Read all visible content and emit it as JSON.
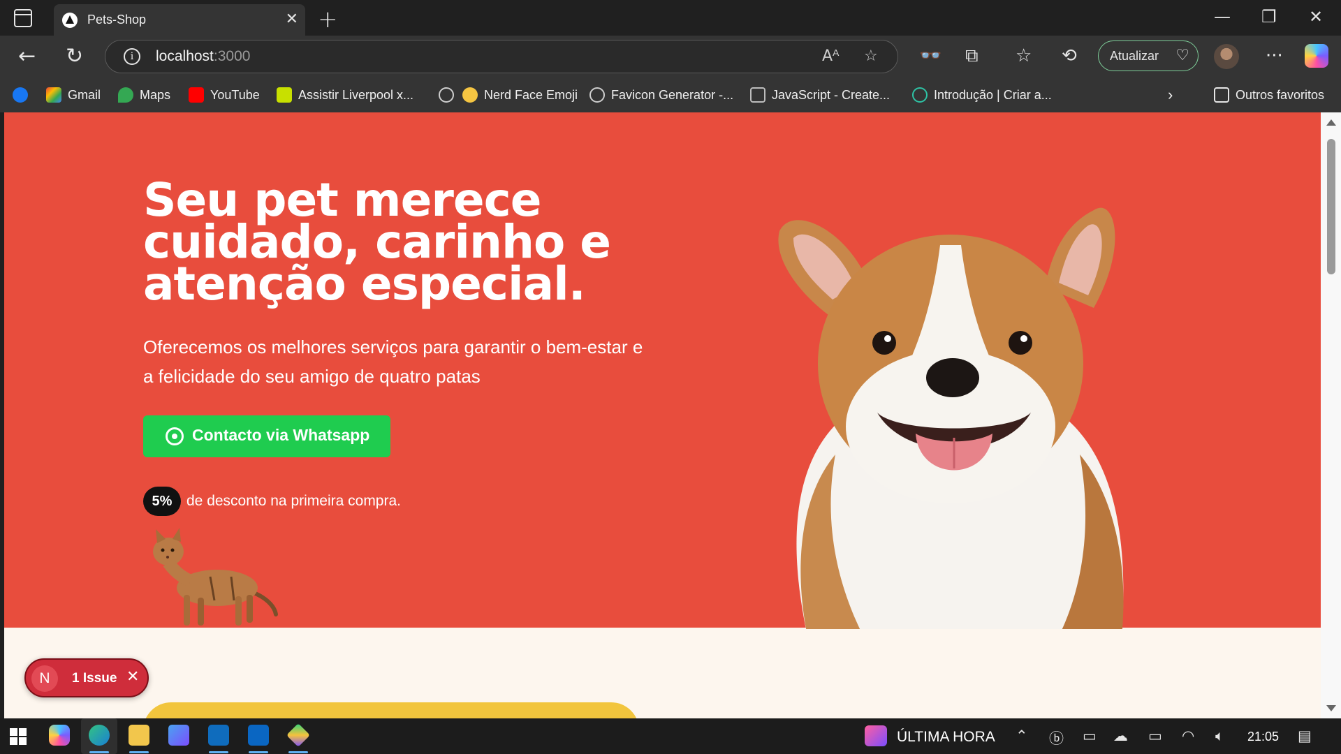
{
  "browser": {
    "tab_title": "Pets-Shop",
    "tab_close": "✕",
    "new_tab": "+",
    "address_host": "localhost",
    "address_port": ":3000",
    "update_label": "Atualizar",
    "window_controls": {
      "minimize": "—",
      "restore": "❐",
      "close": "✕"
    }
  },
  "bookmarks": [
    {
      "label": "",
      "icon": "facebook-icon",
      "color": "#1877f2"
    },
    {
      "label": "Gmail",
      "icon": "gmail-icon",
      "color": "#ea4335"
    },
    {
      "label": "Maps",
      "icon": "maps-icon",
      "color": "#34a853"
    },
    {
      "label": "YouTube",
      "icon": "youtube-icon",
      "color": "#ff0000"
    },
    {
      "label": "Assistir Liverpool x...",
      "icon": "futemax-icon",
      "color": "#c8e000"
    },
    {
      "label": "",
      "icon": "globe-icon",
      "color": "#cfcfcf"
    },
    {
      "label": "Nerd Face Emoji",
      "icon": "nerd-face-icon",
      "color": "#f5c542"
    },
    {
      "label": "Favicon Generator -...",
      "icon": "globe-icon",
      "color": "#cfcfcf"
    },
    {
      "label": "JavaScript - Create...",
      "icon": "javascript-icon",
      "color": "#bdbdbd"
    },
    {
      "label": "Introdução | Criar a...",
      "icon": "react-icon",
      "color": "#2ec4a6"
    },
    {
      "label": "Outros favoritos",
      "icon": "folder-icon",
      "color": "#e6e6e6"
    }
  ],
  "hero": {
    "title": "Seu pet merece cuidado, carinho e atenção especial.",
    "subtitle": "Oferecemos os melhores serviços para garantir o bem-estar e a felicidade do seu amigo de quatro patas",
    "whatsapp_button": "Contacto via Whatsapp",
    "discount_badge": "5%",
    "discount_text": "de desconto na primeira compra.",
    "background_color": "#e84d3d",
    "button_color": "#1fcc4f"
  },
  "dev_overlay": {
    "avatar_letter": "N",
    "issues_label": "1 Issue",
    "close": "✕"
  },
  "taskbar": {
    "news_label": "ÚLTIMA HORA",
    "time": "21:05"
  }
}
